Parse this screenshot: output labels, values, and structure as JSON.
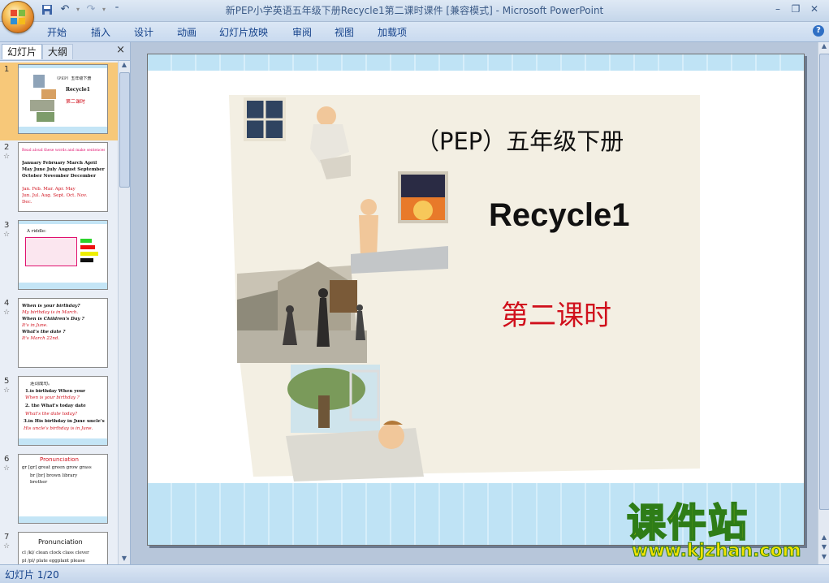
{
  "window": {
    "title": "新PEP小学英语五年级下册Recycle1第二课时课件 [兼容模式] - Microsoft PowerPoint"
  },
  "ribbon": {
    "tabs": [
      "开始",
      "插入",
      "设计",
      "动画",
      "幻灯片放映",
      "审阅",
      "视图",
      "加载项"
    ]
  },
  "panel": {
    "tab_slides": "幻灯片",
    "tab_outline": "大纲",
    "close": "×"
  },
  "thumbnails": [
    {
      "num": "1",
      "lines": [
        "（PEP）五年级下册",
        "Recycle1",
        "第二课时"
      ]
    },
    {
      "num": "2",
      "lines": [
        "Read aloud these words and make sentences",
        "January  February March April",
        "May  June  July  August September",
        "October November  December",
        "Jan.  Feb.  Mar.  Apr.  May",
        "Jun. Jul.  Aug.  Sept.  Oct.  Nov.",
        "Dec."
      ]
    },
    {
      "num": "3",
      "lines": [
        "A riddle:"
      ]
    },
    {
      "num": "4",
      "lines": [
        "When is your birthday?",
        "My birthday is in March.",
        "When is Children's Day ?",
        "It's in June.",
        "What's the date ?",
        "It's March 22nd."
      ]
    },
    {
      "num": "5",
      "lines": [
        "连词成句。",
        "1.is birthday When your",
        "When is your birthday ?",
        "2. the What's today date",
        "What's the date today?",
        "3.in His birthday in June uncle's",
        "His uncle's birthday is in June."
      ]
    },
    {
      "num": "6",
      "lines": [
        "Pronunciation",
        "gr [gr]  great  green  grow  grass",
        "br [br]  brown  library",
        "brother"
      ]
    },
    {
      "num": "7",
      "lines": [
        "Pronunciation",
        "cl /kl/  clean  clock  class  clever",
        "pl /pl/  plate  eggplant  please"
      ]
    }
  ],
  "slide": {
    "title_line1": "（PEP）五年级下册",
    "title_line2": "Recycle1",
    "title_line3": "第二课时"
  },
  "watermark": {
    "text": "课件站",
    "url": "www.kjzhan.com"
  },
  "status": {
    "slide_indicator": "幻灯片 1/20"
  },
  "colors": {
    "accent_red": "#d0101c",
    "ribbon_text": "#15428b",
    "selected_thumb": "#f7c879"
  }
}
